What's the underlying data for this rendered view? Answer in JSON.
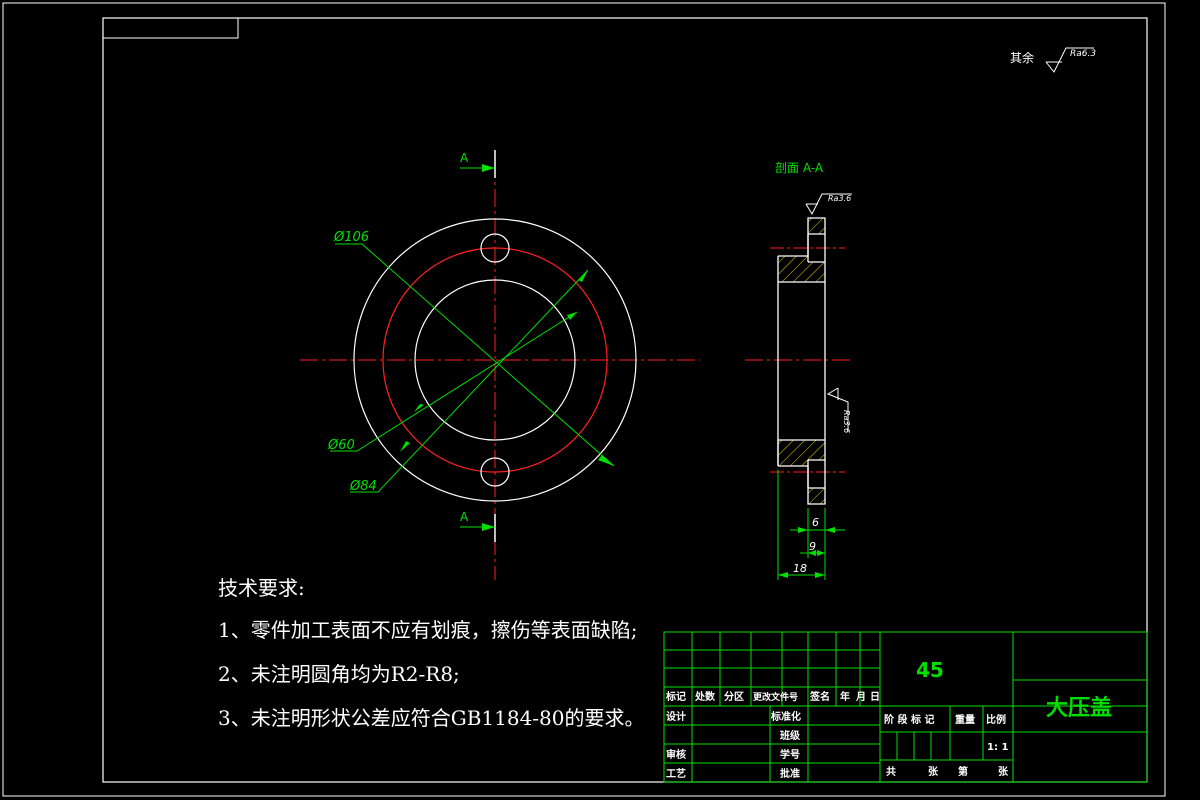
{
  "drawing": {
    "roughness_note_label": "其余",
    "roughness_note_value": "Ra6.3",
    "section_label": "剖面 A-A",
    "section_marker_top": "A",
    "section_marker_bottom": "A",
    "dim_outer": "Ø106",
    "dim_bolt_circle": "Ø84",
    "dim_inner": "Ø60",
    "roughness_top": "Ra3.6",
    "roughness_side": "Ra3.6",
    "dim_6": "6",
    "dim_9": "9",
    "dim_18": "18"
  },
  "notes": {
    "title": "技术要求:",
    "items": [
      "1、零件加工表面不应有划痕，擦伤等表面缺陷;",
      "2、未注明圆角均为R2-R8;",
      "3、未注明形状公差应符合GB1184-80的要求。"
    ]
  },
  "title_block": {
    "material": "45",
    "part_name": "大压盖",
    "headers": [
      "标记",
      "处数",
      "分区",
      "更改文件号",
      "签名",
      "年",
      "月",
      "日"
    ],
    "design": "设计",
    "standardize": "标准化",
    "class": "班级",
    "review": "审核",
    "student_no": "学号",
    "process": "工艺",
    "approve": "批准",
    "stage_mark": "阶 段 标 记",
    "weight": "重量",
    "scale_label": "比例",
    "scale_value": "1: 1",
    "total": "共",
    "sheets": "张",
    "sheet_no": "第",
    "sheet_unit": "张"
  }
}
